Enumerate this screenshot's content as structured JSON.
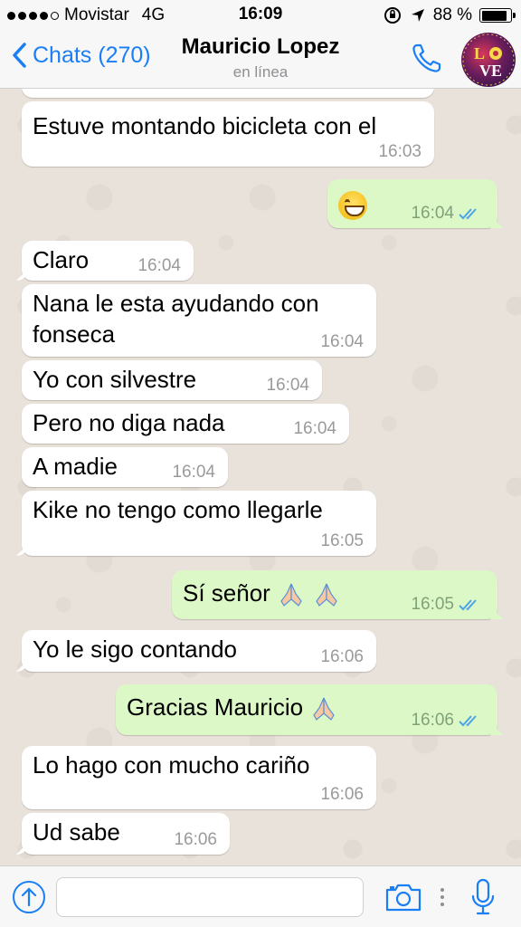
{
  "status_bar": {
    "carrier": "Movistar",
    "network": "4G",
    "time": "16:09",
    "battery": "88 %",
    "battery_level": 0.88,
    "signal_bars": 4
  },
  "header": {
    "back_label": "Chats (270)",
    "contact_name": "Mauricio Lopez",
    "contact_status": "en línea"
  },
  "colors": {
    "accent": "#1a7ef5",
    "outgoing_bubble": "#dcf8c6",
    "incoming_bubble": "#ffffff",
    "read_ticks": "#4fa3e8"
  },
  "messages": [
    {
      "direction": "in",
      "text": "Estuve montando bicicleta con el",
      "time": "16:03"
    },
    {
      "direction": "out",
      "emoji": "grinning-face",
      "time": "16:04",
      "status": "read"
    },
    {
      "direction": "in",
      "text": "Claro",
      "time": "16:04"
    },
    {
      "direction": "in",
      "text": "Nana le esta ayudando con",
      "text2": "fonseca",
      "time": "16:04"
    },
    {
      "direction": "in",
      "text": "Yo con silvestre",
      "time": "16:04"
    },
    {
      "direction": "in",
      "text": "Pero no diga nada",
      "time": "16:04"
    },
    {
      "direction": "in",
      "text": "A madie",
      "time": "16:04"
    },
    {
      "direction": "in",
      "text": "Kike no tengo como llegarle",
      "time": "16:05"
    },
    {
      "direction": "out",
      "text": "Sí señor",
      "emoji": "folded-hands x2",
      "time": "16:05",
      "status": "read"
    },
    {
      "direction": "in",
      "text": "Yo le sigo contando",
      "time": "16:06"
    },
    {
      "direction": "out",
      "text": "Gracias Mauricio",
      "emoji": "folded-hands",
      "time": "16:06",
      "status": "read"
    },
    {
      "direction": "in",
      "text": "Lo hago con mucho cariño",
      "time": "16:06"
    },
    {
      "direction": "in",
      "text": "Ud sabe",
      "time": "16:06"
    }
  ],
  "input": {
    "placeholder": "",
    "value": ""
  },
  "icons": {
    "back": "chevron-left-icon",
    "call": "phone-icon",
    "upload": "upload-arrow-icon",
    "camera": "camera-icon",
    "mic": "microphone-icon"
  }
}
